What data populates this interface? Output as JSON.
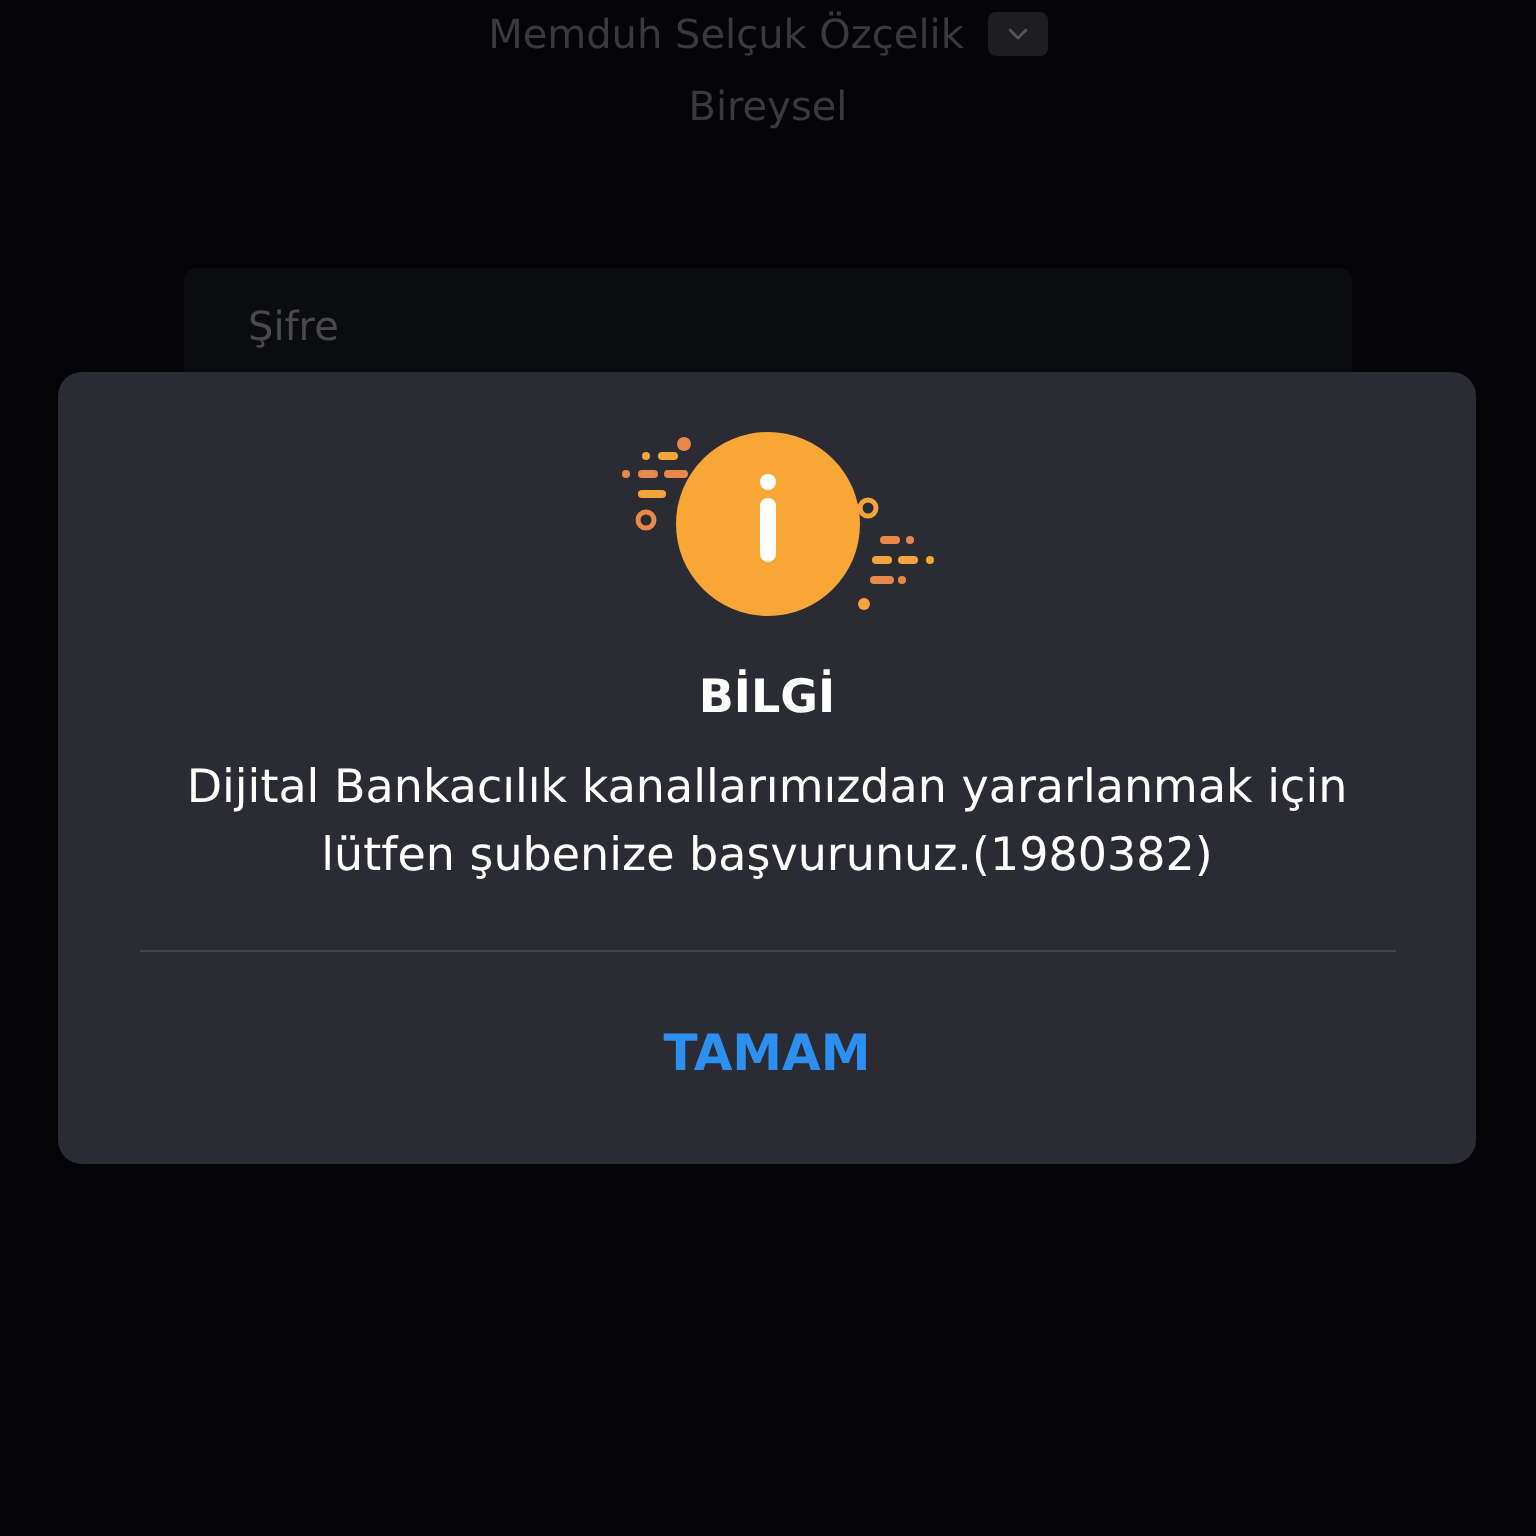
{
  "account": {
    "name": "Memduh Selçuk Özçelik",
    "type": "Bireysel"
  },
  "password_field": {
    "placeholder": "Şifre"
  },
  "dialog": {
    "title": "BİLGİ",
    "message": "Dijital Bankacılık kanallarımızdan yararlanmak için lütfen şubenize başvurunuz.(1980382)",
    "button": "TAMAM"
  }
}
